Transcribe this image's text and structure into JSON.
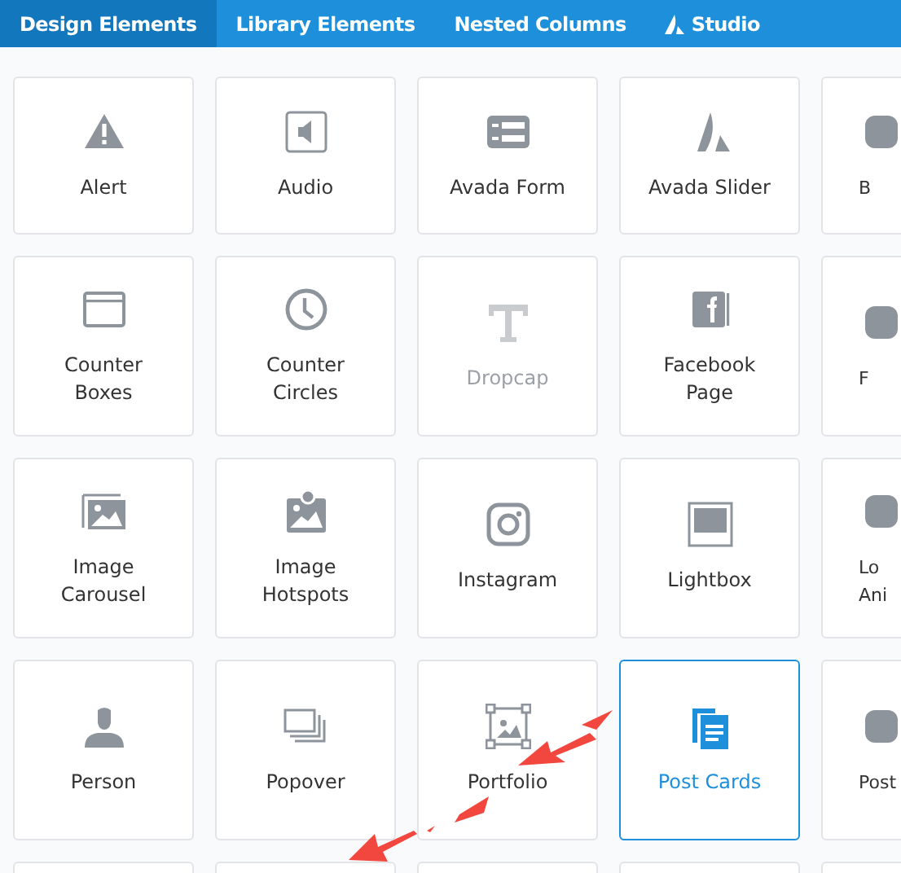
{
  "tabs": [
    {
      "label": "Design Elements",
      "selected": true
    },
    {
      "label": "Library Elements",
      "selected": false
    },
    {
      "label": "Nested Columns",
      "selected": false
    },
    {
      "label": "Studio",
      "selected": false,
      "kind": "studio"
    }
  ],
  "rows": [
    {
      "elements": [
        {
          "label": "Alert",
          "disabled": false,
          "selected": false
        },
        {
          "label": "Audio",
          "disabled": false,
          "selected": false
        },
        {
          "label": "Avada Form",
          "disabled": false,
          "selected": false
        },
        {
          "label": "Avada Slider",
          "disabled": false,
          "selected": false
        },
        {
          "label": "B",
          "disabled": false,
          "selected": false,
          "kind": "cut"
        }
      ]
    },
    {
      "elements": [
        {
          "label": "Counter Boxes",
          "disabled": false,
          "selected": false
        },
        {
          "label": "Counter Circles",
          "disabled": false,
          "selected": false
        },
        {
          "label": "Dropcap",
          "disabled": true,
          "selected": false
        },
        {
          "label": "Facebook Page",
          "disabled": false,
          "selected": false
        },
        {
          "label": "F",
          "disabled": false,
          "selected": false,
          "kind": "cut"
        }
      ]
    },
    {
      "elements": [
        {
          "label": "Image Carousel",
          "disabled": false,
          "selected": false
        },
        {
          "label": "Image Hotspots",
          "disabled": false,
          "selected": false
        },
        {
          "label": "Instagram",
          "disabled": false,
          "selected": false
        },
        {
          "label": "Lightbox",
          "disabled": false,
          "selected": false
        },
        {
          "label": "Lo Ani",
          "disabled": false,
          "selected": false,
          "kind": "cut"
        }
      ]
    },
    {
      "elements": [
        {
          "label": "Person",
          "disabled": false,
          "selected": false
        },
        {
          "label": "Popover",
          "disabled": false,
          "selected": false
        },
        {
          "label": "Portfolio",
          "disabled": false,
          "selected": false
        },
        {
          "label": "Post Cards",
          "disabled": false,
          "selected": true
        },
        {
          "label": "Post",
          "disabled": false,
          "selected": false,
          "kind": "cut"
        }
      ]
    },
    {
      "elements": [
        {
          "kind": "empty"
        },
        {
          "kind": "empty"
        },
        {
          "kind": "empty"
        },
        {
          "kind": "empty"
        },
        {
          "kind": "empty"
        }
      ]
    }
  ],
  "annotation": {
    "kind": "arrow"
  }
}
